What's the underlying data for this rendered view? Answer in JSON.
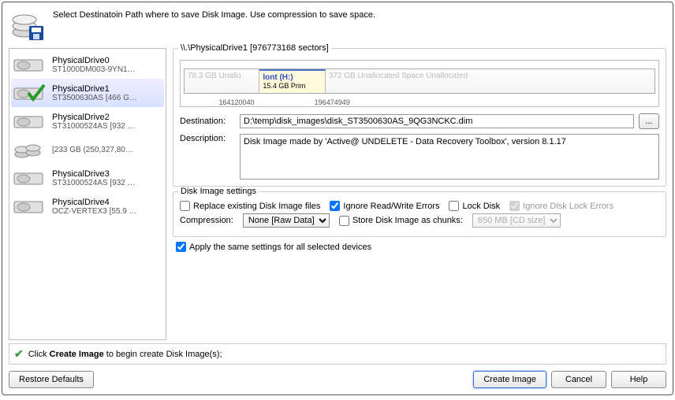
{
  "header": {
    "instruction": "Select Destinatoin Path where to save Disk Image. Use compression to save space."
  },
  "drives": [
    {
      "name": "PhysicalDrive0",
      "sub": "ST1000DM003-9YN1…"
    },
    {
      "name": "PhysicalDrive1",
      "sub": "ST3500630AS [466 G…"
    },
    {
      "name": "PhysicalDrive2",
      "sub": "ST31000524AS [932 …"
    },
    {
      "name": "",
      "sub": "[233 GB (250,327,80…"
    },
    {
      "name": "PhysicalDrive3",
      "sub": "ST31000524AS [932 …"
    },
    {
      "name": "PhysicalDrive4",
      "sub": "OCZ-VERTEX3 [55.9 …"
    }
  ],
  "partition_panel": {
    "title": "\\\\.\\PhysicalDrive1 [976773168 sectors]",
    "seg_unalloc1": "78.3 GB Unallo",
    "seg_part_label": "lont (H:)",
    "seg_part_size": "15.4 GB Prim",
    "seg_unalloc2": "372 GB Unallocated Space Unallocated",
    "tick1": "164120040",
    "tick2": "196474949"
  },
  "form": {
    "destination_label": "Destination:",
    "destination_value": "D:\\temp\\disk_images\\disk_ST3500630AS_9QG3NCKC.dim",
    "browse_label": "...",
    "description_label": "Description:",
    "description_value": "Disk Image made by 'Active@ UNDELETE - Data Recovery Toolbox', version 8.1.17"
  },
  "settings": {
    "legend": "Disk Image settings",
    "replace_label": "Replace existing Disk Image files",
    "ignore_rw_label": "Ignore Read/Write Errors",
    "lock_disk_label": "Lock Disk",
    "ignore_lock_label": "Ignore Disk Lock Errors",
    "compression_label": "Compression:",
    "compression_value": "None [Raw Data]",
    "chunks_label": "Store Disk Image as chunks:",
    "chunk_size_value": "650 MB [CD size]"
  },
  "apply_all_label": "Apply the same settings for all selected devices",
  "status": {
    "prefix": "Click ",
    "bold": "Create Image",
    "suffix": " to begin create Disk Image(s);"
  },
  "buttons": {
    "restore": "Restore Defaults",
    "create": "Create Image",
    "cancel": "Cancel",
    "help": "Help"
  }
}
